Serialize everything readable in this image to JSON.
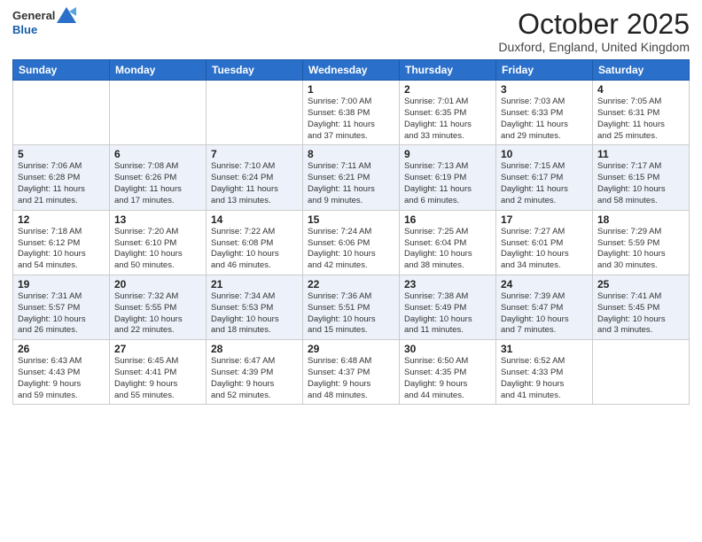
{
  "header": {
    "logo_line1": "General",
    "logo_line2": "Blue",
    "month_title": "October 2025",
    "location": "Duxford, England, United Kingdom"
  },
  "days_of_week": [
    "Sunday",
    "Monday",
    "Tuesday",
    "Wednesday",
    "Thursday",
    "Friday",
    "Saturday"
  ],
  "weeks": [
    [
      {
        "day": "",
        "info": ""
      },
      {
        "day": "",
        "info": ""
      },
      {
        "day": "",
        "info": ""
      },
      {
        "day": "1",
        "info": "Sunrise: 7:00 AM\nSunset: 6:38 PM\nDaylight: 11 hours\nand 37 minutes."
      },
      {
        "day": "2",
        "info": "Sunrise: 7:01 AM\nSunset: 6:35 PM\nDaylight: 11 hours\nand 33 minutes."
      },
      {
        "day": "3",
        "info": "Sunrise: 7:03 AM\nSunset: 6:33 PM\nDaylight: 11 hours\nand 29 minutes."
      },
      {
        "day": "4",
        "info": "Sunrise: 7:05 AM\nSunset: 6:31 PM\nDaylight: 11 hours\nand 25 minutes."
      }
    ],
    [
      {
        "day": "5",
        "info": "Sunrise: 7:06 AM\nSunset: 6:28 PM\nDaylight: 11 hours\nand 21 minutes."
      },
      {
        "day": "6",
        "info": "Sunrise: 7:08 AM\nSunset: 6:26 PM\nDaylight: 11 hours\nand 17 minutes."
      },
      {
        "day": "7",
        "info": "Sunrise: 7:10 AM\nSunset: 6:24 PM\nDaylight: 11 hours\nand 13 minutes."
      },
      {
        "day": "8",
        "info": "Sunrise: 7:11 AM\nSunset: 6:21 PM\nDaylight: 11 hours\nand 9 minutes."
      },
      {
        "day": "9",
        "info": "Sunrise: 7:13 AM\nSunset: 6:19 PM\nDaylight: 11 hours\nand 6 minutes."
      },
      {
        "day": "10",
        "info": "Sunrise: 7:15 AM\nSunset: 6:17 PM\nDaylight: 11 hours\nand 2 minutes."
      },
      {
        "day": "11",
        "info": "Sunrise: 7:17 AM\nSunset: 6:15 PM\nDaylight: 10 hours\nand 58 minutes."
      }
    ],
    [
      {
        "day": "12",
        "info": "Sunrise: 7:18 AM\nSunset: 6:12 PM\nDaylight: 10 hours\nand 54 minutes."
      },
      {
        "day": "13",
        "info": "Sunrise: 7:20 AM\nSunset: 6:10 PM\nDaylight: 10 hours\nand 50 minutes."
      },
      {
        "day": "14",
        "info": "Sunrise: 7:22 AM\nSunset: 6:08 PM\nDaylight: 10 hours\nand 46 minutes."
      },
      {
        "day": "15",
        "info": "Sunrise: 7:24 AM\nSunset: 6:06 PM\nDaylight: 10 hours\nand 42 minutes."
      },
      {
        "day": "16",
        "info": "Sunrise: 7:25 AM\nSunset: 6:04 PM\nDaylight: 10 hours\nand 38 minutes."
      },
      {
        "day": "17",
        "info": "Sunrise: 7:27 AM\nSunset: 6:01 PM\nDaylight: 10 hours\nand 34 minutes."
      },
      {
        "day": "18",
        "info": "Sunrise: 7:29 AM\nSunset: 5:59 PM\nDaylight: 10 hours\nand 30 minutes."
      }
    ],
    [
      {
        "day": "19",
        "info": "Sunrise: 7:31 AM\nSunset: 5:57 PM\nDaylight: 10 hours\nand 26 minutes."
      },
      {
        "day": "20",
        "info": "Sunrise: 7:32 AM\nSunset: 5:55 PM\nDaylight: 10 hours\nand 22 minutes."
      },
      {
        "day": "21",
        "info": "Sunrise: 7:34 AM\nSunset: 5:53 PM\nDaylight: 10 hours\nand 18 minutes."
      },
      {
        "day": "22",
        "info": "Sunrise: 7:36 AM\nSunset: 5:51 PM\nDaylight: 10 hours\nand 15 minutes."
      },
      {
        "day": "23",
        "info": "Sunrise: 7:38 AM\nSunset: 5:49 PM\nDaylight: 10 hours\nand 11 minutes."
      },
      {
        "day": "24",
        "info": "Sunrise: 7:39 AM\nSunset: 5:47 PM\nDaylight: 10 hours\nand 7 minutes."
      },
      {
        "day": "25",
        "info": "Sunrise: 7:41 AM\nSunset: 5:45 PM\nDaylight: 10 hours\nand 3 minutes."
      }
    ],
    [
      {
        "day": "26",
        "info": "Sunrise: 6:43 AM\nSunset: 4:43 PM\nDaylight: 9 hours\nand 59 minutes."
      },
      {
        "day": "27",
        "info": "Sunrise: 6:45 AM\nSunset: 4:41 PM\nDaylight: 9 hours\nand 55 minutes."
      },
      {
        "day": "28",
        "info": "Sunrise: 6:47 AM\nSunset: 4:39 PM\nDaylight: 9 hours\nand 52 minutes."
      },
      {
        "day": "29",
        "info": "Sunrise: 6:48 AM\nSunset: 4:37 PM\nDaylight: 9 hours\nand 48 minutes."
      },
      {
        "day": "30",
        "info": "Sunrise: 6:50 AM\nSunset: 4:35 PM\nDaylight: 9 hours\nand 44 minutes."
      },
      {
        "day": "31",
        "info": "Sunrise: 6:52 AM\nSunset: 4:33 PM\nDaylight: 9 hours\nand 41 minutes."
      },
      {
        "day": "",
        "info": ""
      }
    ]
  ]
}
